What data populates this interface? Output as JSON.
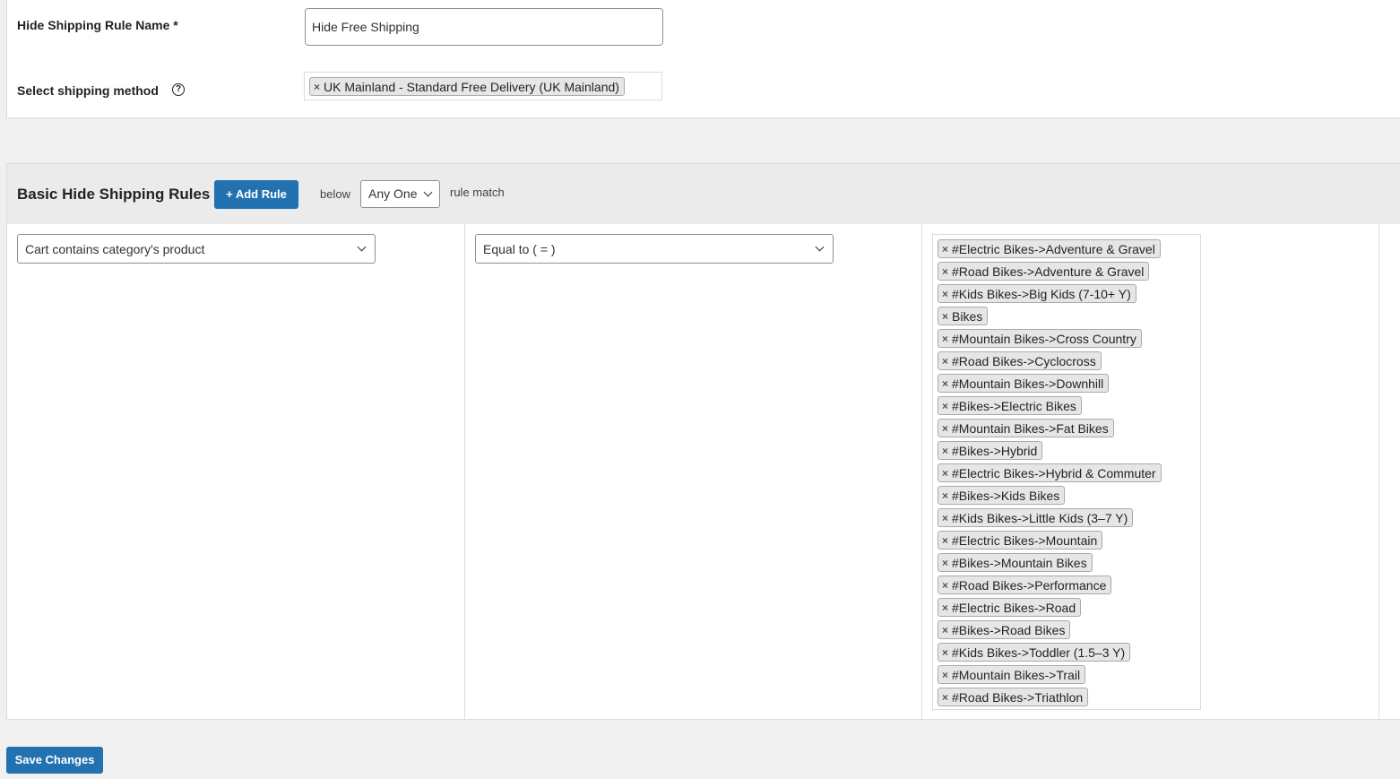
{
  "form": {
    "name_label": "Hide Shipping Rule Name *",
    "name_value": "Hide Free Shipping",
    "method_label": "Select shipping method",
    "help_icon": "question-circle-icon",
    "method_selected": "UK Mainland - Standard Free Delivery (UK Mainland)",
    "remove_icon": "×"
  },
  "rules": {
    "title": "Basic Hide Shipping Rules",
    "add_label": "+ Add Rule",
    "below_text": "below",
    "match_value": "Any One",
    "match_suffix": "rule match",
    "condition_value": "Cart contains category's product",
    "operator_value": "Equal to ( = )",
    "categories": [
      "#Electric Bikes->Adventure & Gravel",
      "#Road Bikes->Adventure & Gravel",
      "#Kids Bikes->Big Kids (7-10+ Y)",
      "Bikes",
      "#Mountain Bikes->Cross Country",
      "#Road Bikes->Cyclocross",
      "#Mountain Bikes->Downhill",
      "#Bikes->Electric Bikes",
      "#Mountain Bikes->Fat Bikes",
      "#Bikes->Hybrid",
      "#Electric Bikes->Hybrid & Commuter",
      "#Bikes->Kids Bikes",
      "#Kids Bikes->Little Kids (3–7 Y)",
      "#Electric Bikes->Mountain",
      "#Bikes->Mountain Bikes",
      "#Road Bikes->Performance",
      "#Electric Bikes->Road",
      "#Bikes->Road Bikes",
      "#Kids Bikes->Toddler (1.5–3 Y)",
      "#Mountain Bikes->Trail",
      "#Road Bikes->Triathlon"
    ]
  },
  "footer": {
    "save_label": "Save Changes"
  },
  "colors": {
    "primary": "#2271b1",
    "page_bg": "#f0f0f1",
    "chip_bg": "#e6e6e6"
  }
}
